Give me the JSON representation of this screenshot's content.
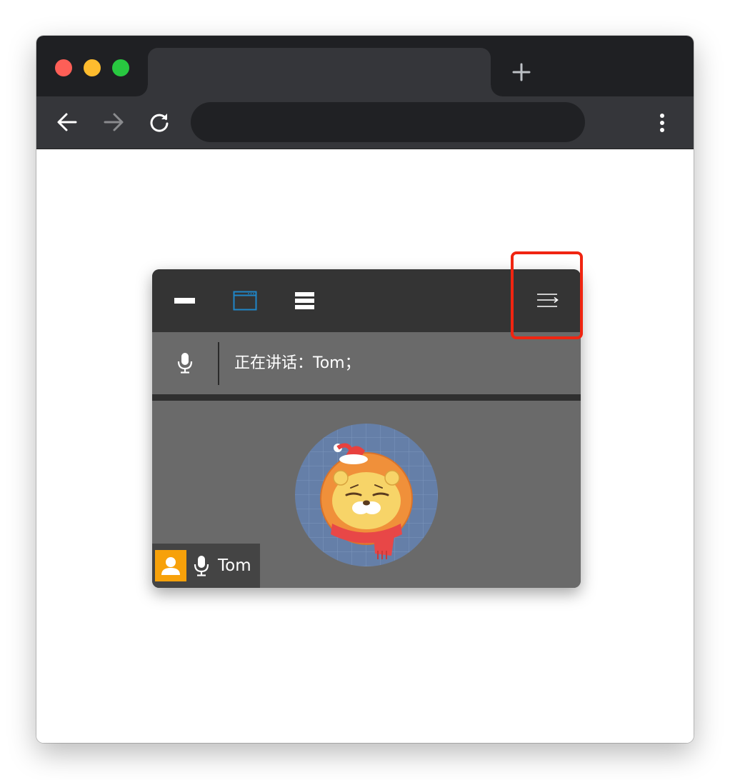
{
  "browser": {
    "tab_title": "",
    "address_value": "",
    "address_placeholder": ""
  },
  "meeting": {
    "speaker_label": "正在讲话：Tom；",
    "participant_name": "Tom"
  },
  "colors": {
    "accent_blue": "#1f86c8",
    "highlight_red": "#f02511",
    "user_badge": "#f7a10a"
  },
  "icons": {
    "minimize": "minimize-icon",
    "window_mode": "window-mode-icon",
    "list_mode": "list-mode-icon",
    "collapse": "collapse-panel-icon",
    "microphone": "microphone-icon",
    "user": "user-icon"
  }
}
